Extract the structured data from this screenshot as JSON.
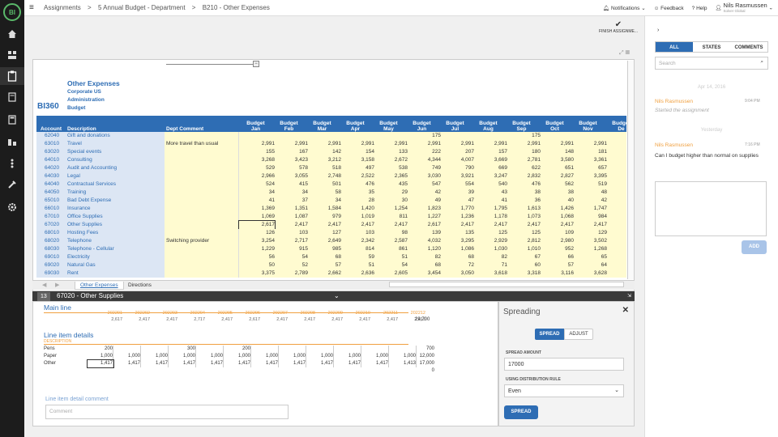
{
  "nav": {
    "logo": "BI",
    "items": [
      "home-icon",
      "org-icon",
      "clipboard-icon",
      "document-icon",
      "calculator-icon",
      "transfer-icon",
      "hierarchy-icon",
      "tools-icon",
      "gear-icon"
    ]
  },
  "topbar": {
    "breadcrumb": [
      "Assignments",
      ">",
      "5 Annual Budget - Department",
      ">",
      "B210 - Other Expenses"
    ],
    "notifications": "Notifications",
    "feedback": "Feedback",
    "help": "Help",
    "user_name": "Nils Rasmussen",
    "user_org": "Solver Global"
  },
  "finish_label": "FINISH ASSIGNME...",
  "report": {
    "title": "Other Expenses",
    "company": "Corporate US",
    "department": "Administration",
    "scenario": "Budget",
    "logo": "BI360",
    "headers": {
      "account": "Account",
      "description": "Description",
      "dept_comment": "Dept Comment"
    },
    "months": [
      {
        "top": "Budget",
        "bottom": "Jan"
      },
      {
        "top": "Budget",
        "bottom": "Feb"
      },
      {
        "top": "Budget",
        "bottom": "Mar"
      },
      {
        "top": "Budget",
        "bottom": "Apr"
      },
      {
        "top": "Budget",
        "bottom": "May"
      },
      {
        "top": "Budget",
        "bottom": "Jun"
      },
      {
        "top": "Budget",
        "bottom": "Jul"
      },
      {
        "top": "Budget",
        "bottom": "Aug"
      },
      {
        "top": "Budget",
        "bottom": "Sep"
      },
      {
        "top": "Budget",
        "bottom": "Oct"
      },
      {
        "top": "Budget",
        "bottom": "Nov"
      },
      {
        "top": "Budget",
        "bottom": "De"
      }
    ],
    "rows": [
      {
        "acct": "62040",
        "desc": "Gift and donations",
        "cmt": "",
        "v": [
          "",
          "",
          "",
          "",
          "",
          "175",
          "",
          "",
          "175",
          "",
          ""
        ]
      },
      {
        "acct": "63010",
        "desc": "Travel",
        "cmt": "More travel than usual",
        "v": [
          "2,991",
          "2,991",
          "2,991",
          "2,991",
          "2,991",
          "2,991",
          "2,991",
          "2,991",
          "2,991",
          "2,991",
          "2,991"
        ]
      },
      {
        "acct": "63020",
        "desc": "Special events",
        "cmt": "",
        "v": [
          "155",
          "167",
          "142",
          "154",
          "133",
          "222",
          "207",
          "157",
          "180",
          "148",
          "181"
        ]
      },
      {
        "acct": "64010",
        "desc": "Consulting",
        "cmt": "",
        "v": [
          "3,268",
          "3,423",
          "3,212",
          "3,158",
          "2,672",
          "4,344",
          "4,007",
          "3,669",
          "2,781",
          "3,580",
          "3,361"
        ]
      },
      {
        "acct": "64020",
        "desc": "Audit and Accounting",
        "cmt": "",
        "v": [
          "529",
          "578",
          "518",
          "497",
          "538",
          "749",
          "790",
          "669",
          "622",
          "651",
          "657"
        ]
      },
      {
        "acct": "64030",
        "desc": "Legal",
        "cmt": "",
        "v": [
          "2,966",
          "3,055",
          "2,748",
          "2,522",
          "2,365",
          "3,030",
          "3,921",
          "3,247",
          "2,832",
          "2,827",
          "3,395"
        ]
      },
      {
        "acct": "64040",
        "desc": "Contractual Services",
        "cmt": "",
        "v": [
          "524",
          "415",
          "501",
          "476",
          "435",
          "547",
          "554",
          "540",
          "476",
          "562",
          "519"
        ]
      },
      {
        "acct": "64050",
        "desc": "Training",
        "cmt": "",
        "v": [
          "34",
          "34",
          "58",
          "35",
          "29",
          "42",
          "39",
          "43",
          "38",
          "38",
          "48"
        ]
      },
      {
        "acct": "65010",
        "desc": "Bad Debt Expense",
        "cmt": "",
        "v": [
          "41",
          "37",
          "34",
          "28",
          "30",
          "49",
          "47",
          "41",
          "36",
          "40",
          "42"
        ]
      },
      {
        "acct": "66010",
        "desc": "Insurance",
        "cmt": "",
        "v": [
          "1,369",
          "1,351",
          "1,584",
          "1,420",
          "1,254",
          "1,823",
          "1,770",
          "1,795",
          "1,613",
          "1,426",
          "1,747"
        ]
      },
      {
        "acct": "67010",
        "desc": "Office Supplies",
        "cmt": "",
        "v": [
          "1,069",
          "1,087",
          "979",
          "1,019",
          "811",
          "1,227",
          "1,236",
          "1,178",
          "1,073",
          "1,068",
          "984"
        ]
      },
      {
        "acct": "67020",
        "desc": "Other Supplies",
        "cmt": "",
        "v": [
          "2,617",
          "2,417",
          "2,417",
          "2,417",
          "2,417",
          "2,617",
          "2,417",
          "2,417",
          "2,417",
          "2,417",
          "2,417"
        ]
      },
      {
        "acct": "68010",
        "desc": "Hosting Fees",
        "cmt": "",
        "v": [
          "126",
          "103",
          "127",
          "103",
          "98",
          "139",
          "135",
          "125",
          "125",
          "109",
          "129"
        ]
      },
      {
        "acct": "68020",
        "desc": "Telephone",
        "cmt": "Switching provider",
        "v": [
          "3,254",
          "2,717",
          "2,649",
          "2,342",
          "2,587",
          "4,032",
          "3,295",
          "2,929",
          "2,812",
          "2,980",
          "3,502"
        ]
      },
      {
        "acct": "68030",
        "desc": "Telephone - Cellular",
        "cmt": "",
        "v": [
          "1,229",
          "915",
          "985",
          "814",
          "861",
          "1,120",
          "1,086",
          "1,030",
          "1,010",
          "952",
          "1,268"
        ]
      },
      {
        "acct": "69010",
        "desc": "Electricity",
        "cmt": "",
        "v": [
          "56",
          "54",
          "68",
          "59",
          "51",
          "82",
          "68",
          "82",
          "67",
          "66",
          "65"
        ]
      },
      {
        "acct": "69020",
        "desc": "Natural Gas",
        "cmt": "",
        "v": [
          "50",
          "52",
          "57",
          "51",
          "54",
          "68",
          "72",
          "71",
          "60",
          "57",
          "64"
        ]
      },
      {
        "acct": "69030",
        "desc": "Rent",
        "cmt": "",
        "v": [
          "3,375",
          "2,789",
          "2,662",
          "2,636",
          "2,605",
          "3,454",
          "3,050",
          "3,618",
          "3,318",
          "3,116",
          "3,628"
        ]
      }
    ]
  },
  "sheet_tabs": [
    {
      "label": "Other Expenses"
    },
    {
      "label": "Directions"
    }
  ],
  "detail": {
    "row_number": "13",
    "title": "67020 - Other Supplies",
    "main_line_label": "Main line",
    "periods": [
      "202201",
      "202202",
      "202203",
      "202204",
      "202205",
      "202206",
      "202207",
      "202208",
      "202209",
      "202210",
      "202211",
      "202212"
    ],
    "main_values": [
      "2,617",
      "2,417",
      "2,417",
      "2,717",
      "2,417",
      "2,617",
      "2,417",
      "2,417",
      "2,417",
      "2,417",
      "2,417",
      "2,413"
    ],
    "main_total": "29,700",
    "line_item_label": "Line item details",
    "description_label": "DESCRIPTION",
    "line_items": [
      {
        "name": "Pens",
        "v": [
          "200",
          "",
          "",
          "300",
          "",
          "200",
          "",
          "",
          "",
          "",
          "",
          ""
        ],
        "total": "700"
      },
      {
        "name": "Paper",
        "v": [
          "1,000",
          "1,000",
          "1,000",
          "1,000",
          "1,000",
          "1,000",
          "1,000",
          "1,000",
          "1,000",
          "1,000",
          "1,000",
          "1,000"
        ],
        "total": "12,000"
      },
      {
        "name": "Other",
        "v": [
          "1,417",
          "1,417",
          "1,417",
          "1,417",
          "1,417",
          "1,417",
          "1,417",
          "1,417",
          "1,417",
          "1,417",
          "1,417",
          "1,413"
        ],
        "total": "17,000"
      }
    ],
    "blank_total": "0",
    "comment_label": "Line item detail comment",
    "comment_placeholder": "Comment"
  },
  "spreading": {
    "title": "Spreading",
    "tab_spread": "SPREAD",
    "tab_adjust": "ADJUST",
    "amount_label": "SPREAD AMOUNT",
    "amount_value": "17000",
    "rule_label": "USING DISTRIBUTION RULE",
    "rule_value": "Even",
    "button": "SPREAD"
  },
  "comments": {
    "tabs": [
      "ALL",
      "STATES",
      "COMMENTS"
    ],
    "search_placeholder": "Search",
    "date_divider": "Apr 14, 2016",
    "today_divider": "Yesterday",
    "entries": [
      {
        "author": "Nils Rasmussen",
        "time": "9:04 PM",
        "text": "Started the assignment"
      },
      {
        "author": "Nils Rasmussen",
        "time": "7:16 PM",
        "text": "Can I budget higher than normal on supplies"
      }
    ],
    "add_button": "ADD"
  },
  "colors": {
    "accent": "#2e6db4",
    "orange": "#f0a040",
    "nav_bg": "#1c1c1c",
    "green": "#5ab96a"
  }
}
